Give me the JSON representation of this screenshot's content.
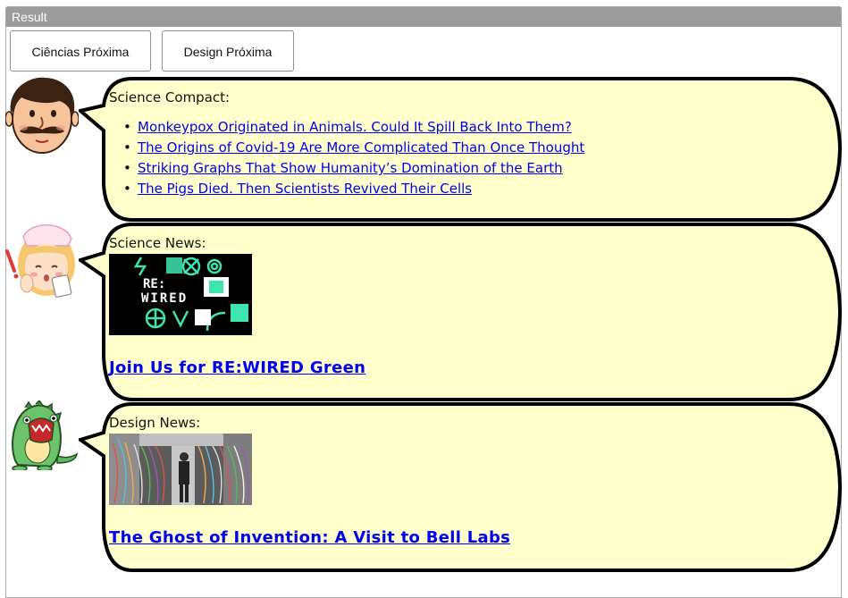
{
  "result_bar": {
    "title": "Result"
  },
  "buttons": [
    {
      "label": "Ciências Próxima"
    },
    {
      "label": "Design Próxima"
    }
  ],
  "sections": [
    {
      "avatar": "mustache-man",
      "heading": "Science Compact:",
      "links": [
        "Monkeypox Originated in Animals. Could It Spill Back Into Them?",
        "The Origins of Covid-19 Are More Complicated Than Once Thought",
        "Striking Graphs That Show Humanity’s Domination of the Earth",
        "The Pigs Died. Then Scientists Revived Their Cells"
      ]
    },
    {
      "avatar": "nurse",
      "heading": "Science News:",
      "image": "rewired-logo",
      "image_text": [
        "RE:",
        "WIRED"
      ],
      "article": "Join Us for RE:WIRED Green"
    },
    {
      "avatar": "green-dinosaur",
      "heading": "Design News:",
      "image": "bell-labs-cables",
      "article": "The Ghost of Invention: A Visit to Bell Labs"
    }
  ],
  "colors": {
    "bubble": "#ffffcc",
    "link": "#0000ee",
    "result_bar": "#9c9c9c"
  }
}
